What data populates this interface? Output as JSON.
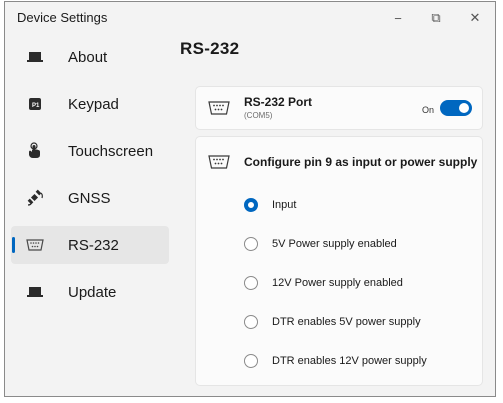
{
  "window": {
    "title": "Device Settings",
    "minimize_glyph": "−",
    "maximize_glyph": "⧉",
    "close_glyph": "✕"
  },
  "sidebar": {
    "items": [
      {
        "label": "About",
        "icon": "laptop-icon",
        "active": false
      },
      {
        "label": "Keypad",
        "icon": "keypad-icon",
        "active": false
      },
      {
        "label": "Touchscreen",
        "icon": "touch-hand-icon",
        "active": false
      },
      {
        "label": "GNSS",
        "icon": "satellite-icon",
        "active": false
      },
      {
        "label": "RS-232",
        "icon": "serial-port-icon",
        "active": true
      },
      {
        "label": "Update",
        "icon": "laptop-icon",
        "active": false
      }
    ]
  },
  "page": {
    "title": "RS-232",
    "port": {
      "title": "RS-232 Port",
      "subtitle": "(COM5)",
      "toggle_state": "On",
      "toggle_on": true
    },
    "pin9": {
      "title": "Configure pin 9 as input or power supply",
      "selected_index": 0,
      "options": [
        "Input",
        "5V Power supply enabled",
        "12V Power supply enabled",
        "DTR enables 5V power supply",
        "DTR enables 12V power supply"
      ]
    }
  },
  "colors": {
    "accent": "#0067c0",
    "window_bg": "#f3f3f3",
    "card_bg": "#fbfbfb"
  }
}
